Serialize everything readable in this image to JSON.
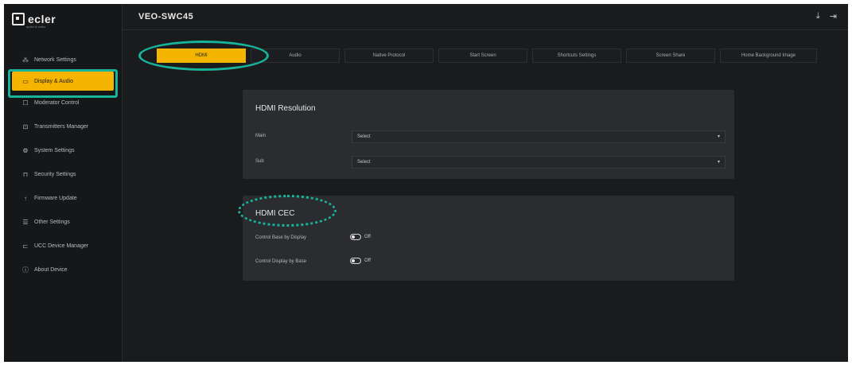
{
  "brand": {
    "logo_text": "ecler",
    "logo_subtext": "audio & video"
  },
  "header": {
    "device_name": "VEO-SWC45",
    "icons": [
      "download-icon",
      "logout-icon"
    ]
  },
  "sidebar": {
    "items": [
      {
        "label": "Network Settings",
        "icon": "network-icon",
        "glyph": "⁂"
      },
      {
        "label": "Display & Audio",
        "icon": "display-icon",
        "glyph": "▭",
        "active": true
      },
      {
        "label": "Moderator Control",
        "icon": "moderator-icon",
        "glyph": "☐"
      },
      {
        "label": "Transmitters Manager",
        "icon": "transmitter-icon",
        "glyph": "⊡"
      },
      {
        "label": "System Settings",
        "icon": "gear-icon",
        "glyph": "⚙"
      },
      {
        "label": "Security Settings",
        "icon": "lock-icon",
        "glyph": "⊓"
      },
      {
        "label": "Firmware Update",
        "icon": "upload-icon",
        "glyph": "↑"
      },
      {
        "label": "Other Settings",
        "icon": "sliders-icon",
        "glyph": "☰"
      },
      {
        "label": "UCC Device Manager",
        "icon": "device-icon",
        "glyph": "⊏"
      },
      {
        "label": "About Device",
        "icon": "info-icon",
        "glyph": "ⓘ"
      }
    ]
  },
  "tabs": [
    {
      "label": "HDMI",
      "active": true,
      "width": 112
    },
    {
      "label": "Audio",
      "width": 112
    },
    {
      "label": "Native Protocol",
      "width": 112
    },
    {
      "label": "Start Screen",
      "width": 112
    },
    {
      "label": "Shortcuts Settings",
      "width": 112
    },
    {
      "label": "Screen Share",
      "width": 112
    },
    {
      "label": "Home Background Image",
      "width": 122
    }
  ],
  "hdmi_resolution": {
    "title": "HDMI Resolution",
    "main_label": "Main",
    "main_value": "Select",
    "sub_label": "Sub",
    "sub_value": "Select"
  },
  "hdmi_cec": {
    "title": "HDMI CEC",
    "control_base_label": "Control Base by Display",
    "control_base_state": "Off",
    "control_display_label": "Control Display by Base",
    "control_display_state": "Off"
  },
  "colors": {
    "accent": "#f5b400",
    "highlight": "#17b39b",
    "background": "#1a1b1d",
    "panel": "#2b2c30"
  }
}
